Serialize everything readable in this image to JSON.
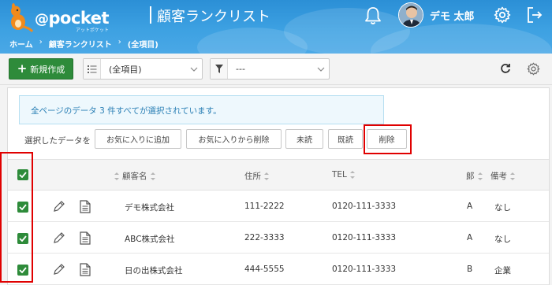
{
  "header": {
    "logo_at": "@",
    "logo_word": "pocket",
    "logo_sub": "アットポケット",
    "title": "顧客ランクリスト",
    "user_name": "デモ 太郎"
  },
  "breadcrumb": {
    "home": "ホーム",
    "sep1": "›",
    "list": "顧客ランクリスト",
    "sep2": "›",
    "current": "(全項目)"
  },
  "toolbar": {
    "new_label": "新規作成",
    "view_value": "(全項目)",
    "filter_value": "---"
  },
  "selection": {
    "notice": "全ページのデータ 3 件すべてが選択されています。",
    "actions_label": "選択したデータを",
    "add_favorite": "お気に入りに追加",
    "remove_favorite": "お気に入りから削除",
    "unread": "未読",
    "read": "既読",
    "delete": "削除"
  },
  "table": {
    "columns": {
      "name": "顧客名",
      "address": "住所",
      "tel": "TEL",
      "rank": "郞",
      "note": "備考"
    },
    "rows": [
      {
        "name": "デモ株式会社",
        "address": "111-2222",
        "tel": "0120-111-3333",
        "rank": "A",
        "note": "なし",
        "checked": true
      },
      {
        "name": "ABC株式会社",
        "address": "222-3333",
        "tel": "0120-111-3333",
        "rank": "A",
        "note": "なし",
        "checked": true
      },
      {
        "name": "日の出株式会社",
        "address": "444-5555",
        "tel": "0120-111-3333",
        "rank": "B",
        "note": "企業",
        "checked": true
      }
    ]
  },
  "colors": {
    "header_blue": "#3da1e2",
    "primary_green": "#2e8b3a",
    "highlight_red": "#e00000",
    "notice_text": "#2a7fb5"
  },
  "icons": {
    "logo": "kangaroo-logo",
    "bell": "bell-icon",
    "gear": "gear-icon",
    "logout": "logout-icon",
    "list": "list-icon",
    "filter": "filter-icon",
    "refresh": "refresh-icon",
    "edit": "pencil-icon",
    "detail": "document-icon"
  }
}
